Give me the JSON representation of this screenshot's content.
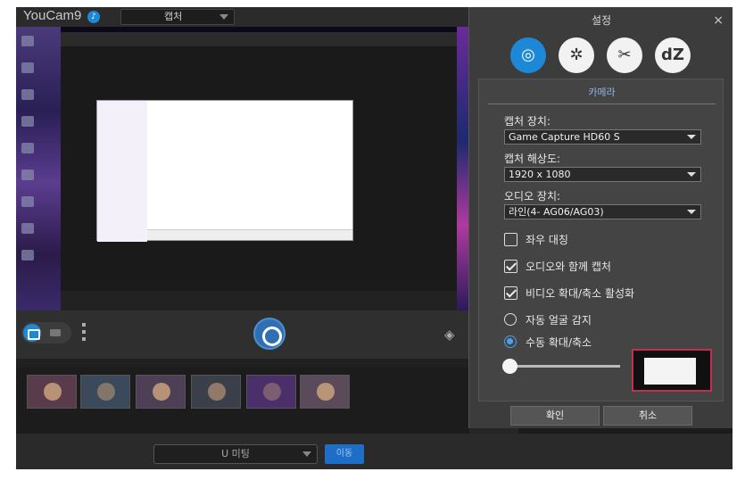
{
  "app": {
    "name": "YouCam9",
    "mode": "캡처"
  },
  "icons": {
    "notification": "bell-icon",
    "camera": "camera-icon",
    "video": "video-icon",
    "more": "more-dots-icon",
    "shutter": "shutter-icon",
    "effects": "layers-icon",
    "close": "close-icon"
  },
  "settings": {
    "title": "설정",
    "close_glyph": "×",
    "tabs": [
      {
        "name": "camera-tab",
        "glyph": "◎",
        "active": true
      },
      {
        "name": "aperture-tab",
        "glyph": "✲",
        "active": false
      },
      {
        "name": "tools-tab",
        "glyph": "✂",
        "active": false
      },
      {
        "name": "dz-tab",
        "glyph": "dZ",
        "active": false
      }
    ],
    "section_title": "카메라",
    "capture_device": {
      "label": "캡처 장치:",
      "value": "Game Capture HD60 S"
    },
    "capture_resolution": {
      "label": "캡처 해상도:",
      "value": "1920 x 1080"
    },
    "audio_device": {
      "label": "오디오 장치:",
      "value": "라인(4- AG06/AG03)"
    },
    "options": [
      {
        "label": "좌우 대칭",
        "checked": false
      },
      {
        "label": "오디오와 함께 캡처",
        "checked": true
      },
      {
        "label": "비디오 확대/축소 활성화",
        "checked": true
      }
    ],
    "radios": [
      {
        "label": "자동 얼굴 감지",
        "selected": false
      },
      {
        "label": "수동 확대/축소",
        "selected": true
      }
    ],
    "zoom_level": 0.0,
    "ok": "확인",
    "cancel": "취소"
  },
  "bottom": {
    "meeting_select": "U 미팅",
    "go_button": "이동"
  }
}
